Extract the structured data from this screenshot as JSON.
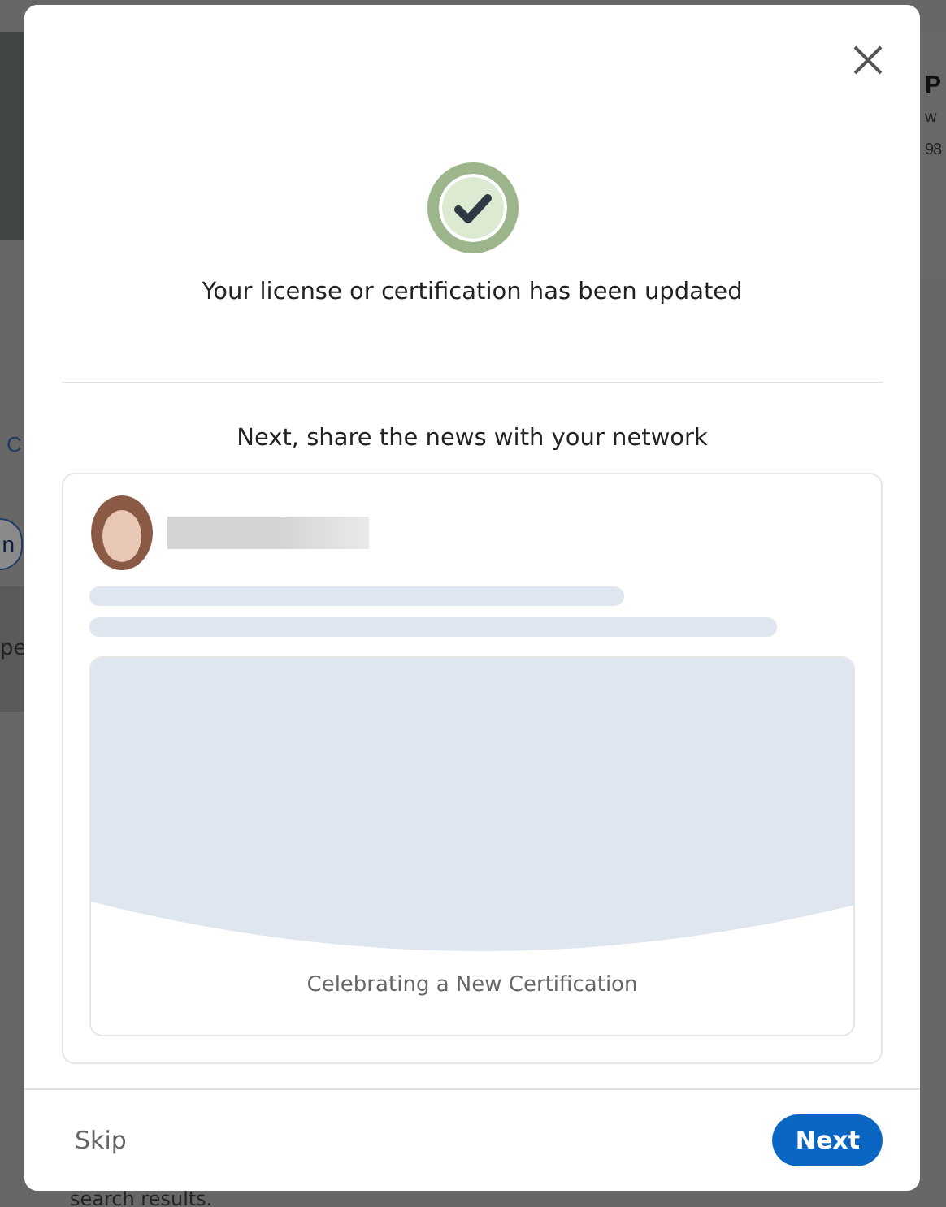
{
  "background": {
    "left_items": [
      {
        "kind": "link",
        "text": "C"
      },
      {
        "kind": "pill",
        "text": "n"
      },
      {
        "kind": "text",
        "text": "pe"
      }
    ],
    "right_card": {
      "title": "P",
      "lines": [
        "w",
        "98"
      ]
    },
    "footer_text": "search results."
  },
  "dialog": {
    "status": "Your license or certification has been updated",
    "prompt": "Next, share the news with your network",
    "preview": {
      "image_caption": "Celebrating a New Certification"
    },
    "buttons": [
      {
        "label": "Skip",
        "kind": "text"
      },
      {
        "label": "Next",
        "kind": "primary"
      }
    ]
  }
}
